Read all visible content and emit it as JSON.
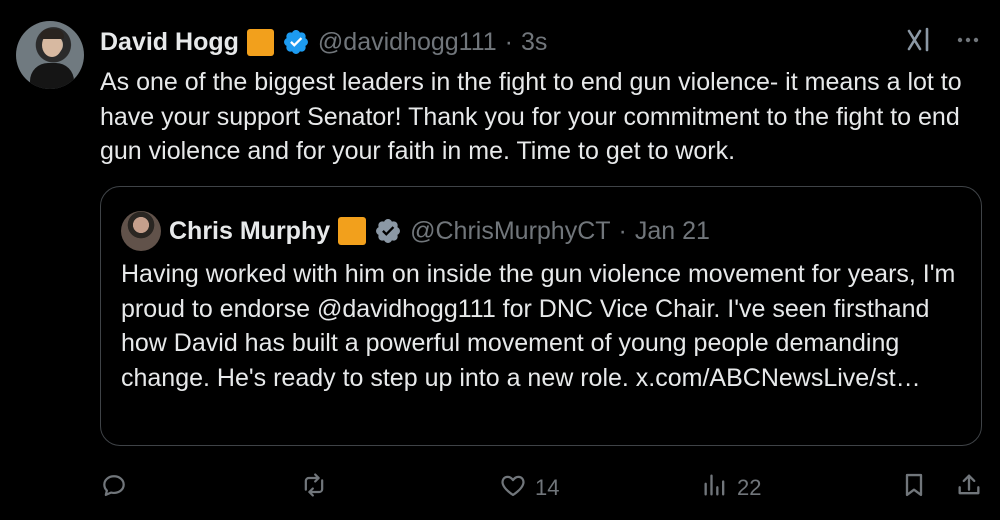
{
  "author": {
    "name": "David Hogg",
    "handle": "@davidhogg111",
    "time": "3s",
    "separator": "·"
  },
  "tweet": {
    "text": "As one of the biggest leaders in the fight to end gun violence- it means a lot to have your support Senator! Thank you for your commitment to the fight to end gun violence and for your faith in me. Time to get to work."
  },
  "quoted": {
    "name": "Chris Murphy",
    "handle": "@ChrisMurphyCT",
    "date": "Jan 21",
    "separator": "·",
    "text": "Having worked with him on inside the gun violence movement for years, I'm proud to endorse @davidhogg111 for DNC Vice Chair. I've seen firsthand how David has built a powerful movement of young people demanding change. He's ready to step up into a new role. x.com/ABCNewsLive/st…"
  },
  "actions": {
    "likes": "14",
    "views": "22"
  },
  "icons": {
    "badge": "orange-square-badge",
    "verified": "verified-badge-icon",
    "grok": "grok-icon",
    "more": "more-icon",
    "reply": "reply-icon",
    "repost": "repost-icon",
    "like": "heart-icon",
    "views": "views-icon",
    "bookmark": "bookmark-icon",
    "share": "share-icon"
  },
  "colors": {
    "background": "#000000",
    "text": "#e7e9ea",
    "muted": "#71767b",
    "verified": "#1d9bf0",
    "badge": "#f2a01c",
    "border": "#3f4347"
  }
}
